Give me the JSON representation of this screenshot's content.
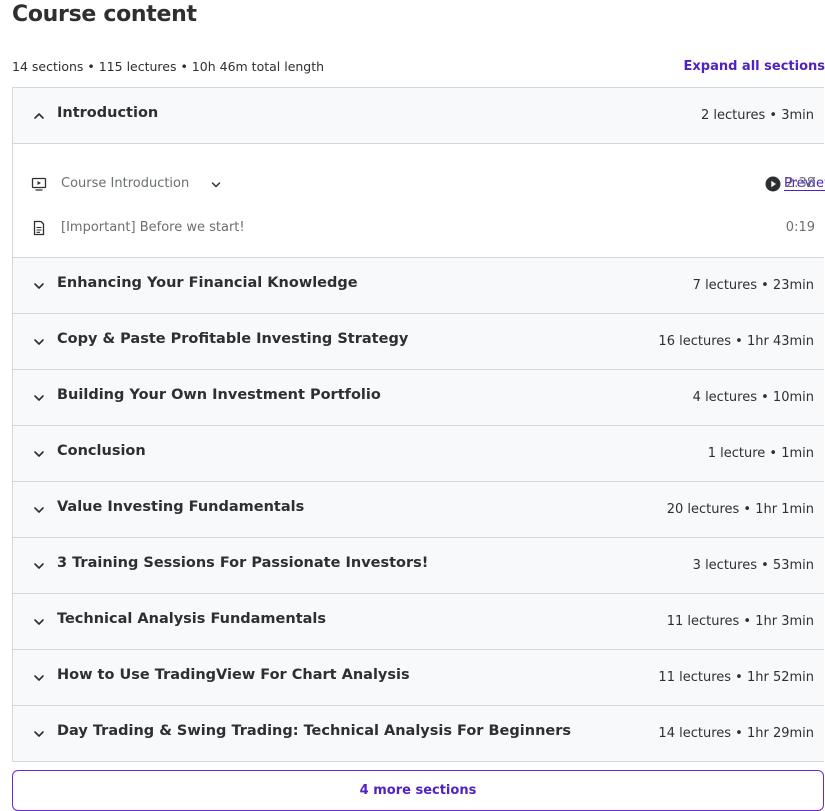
{
  "header": {
    "title": "Course content",
    "meta": "14 sections • 115 lectures • 10h 46m total length",
    "expand_all_label": "Expand all sections"
  },
  "colors": {
    "accent": "#5022c3",
    "section_bg": "#f7f9fa",
    "border": "#d1d7dc"
  },
  "sections": [
    {
      "title": "Introduction",
      "stats": "2 lectures • 3min",
      "expanded": true,
      "icon": "chevron-up-icon"
    },
    {
      "title": "Enhancing Your Financial Knowledge",
      "stats": "7 lectures • 23min",
      "icon": "chevron-down-icon"
    },
    {
      "title": "Copy & Paste Profitable Investing Strategy",
      "stats": "16 lectures • 1hr 43min",
      "icon": "chevron-down-icon"
    },
    {
      "title": "Building Your Own Investment Portfolio",
      "stats": "4 lectures • 10min",
      "icon": "chevron-down-icon"
    },
    {
      "title": "Conclusion",
      "stats": "1 lecture • 1min",
      "icon": "chevron-down-icon"
    },
    {
      "title": "Value Investing Fundamentals",
      "stats": "20 lectures • 1hr 1min",
      "icon": "chevron-down-icon"
    },
    {
      "title": "3 Training Sessions For Passionate Investors!",
      "stats": "3 lectures • 53min",
      "icon": "chevron-down-icon"
    },
    {
      "title": "Technical Analysis Fundamentals",
      "stats": "11 lectures • 1hr 3min",
      "icon": "chevron-down-icon"
    },
    {
      "title": "How to Use TradingView For Chart Analysis",
      "stats": "11 lectures • 1hr 52min",
      "icon": "chevron-down-icon"
    },
    {
      "title": "Day Trading & Swing Trading: Technical Analysis For Beginners",
      "stats": "14 lectures • 1hr 29min",
      "icon": "chevron-down-icon"
    }
  ],
  "lectures": [
    {
      "title": "Course Introduction",
      "icon": "video-icon",
      "preview_label": "Preview",
      "duration": "2:38"
    },
    {
      "title": "[Important] Before we start!",
      "icon": "article-icon",
      "duration": "0:19"
    }
  ],
  "more_sections_label": "4 more sections"
}
